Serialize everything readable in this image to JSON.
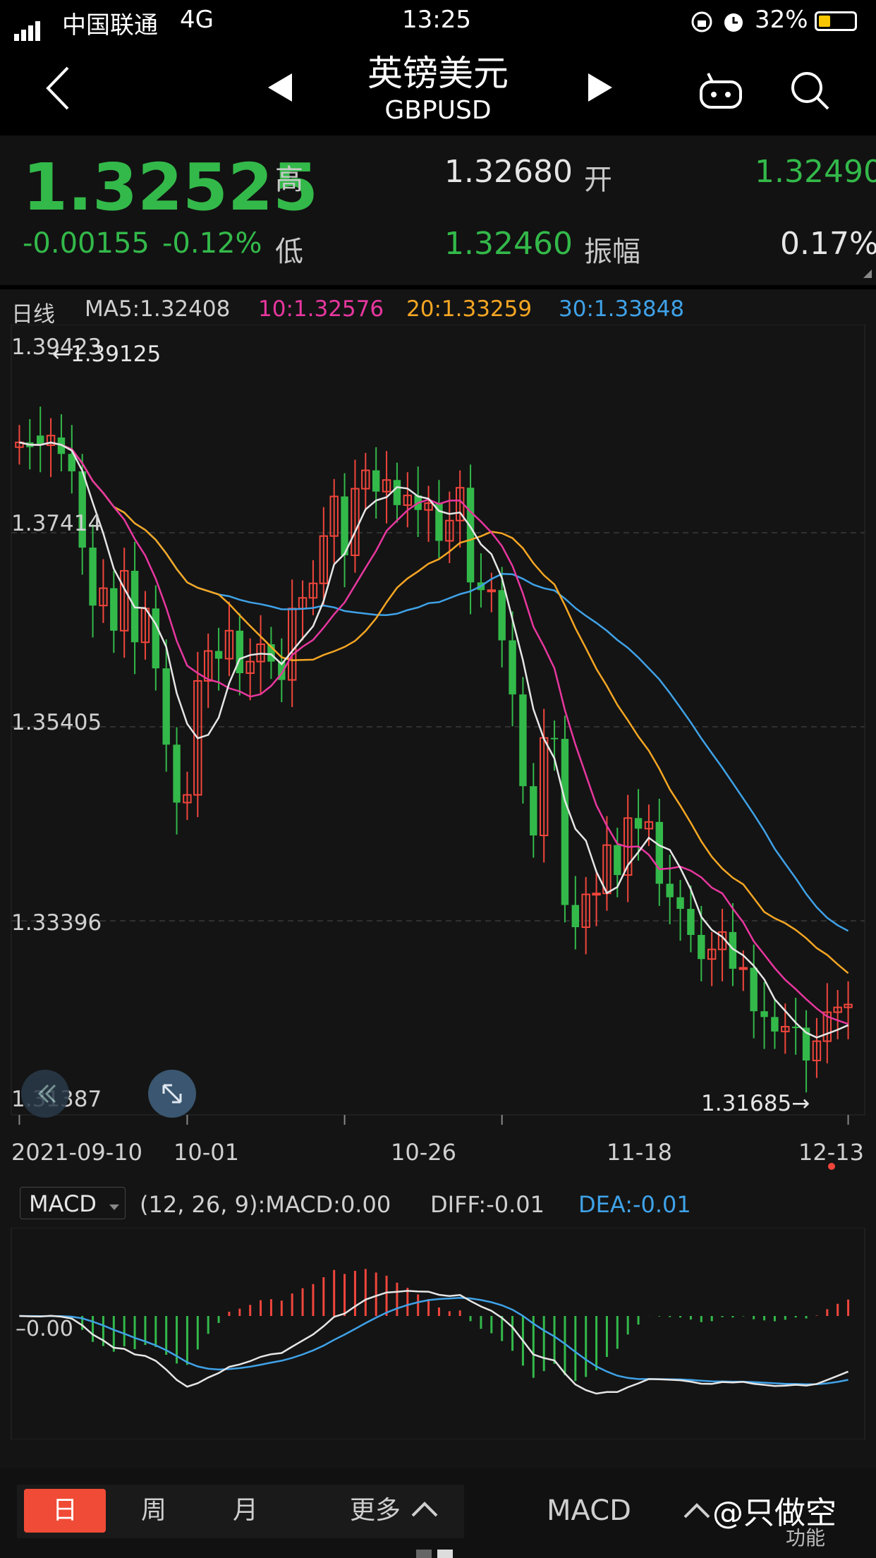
{
  "status": {
    "carrier": "中国联通",
    "network": "4G",
    "time": "13:25",
    "battery": "32%"
  },
  "nav": {
    "title": "英镑美元",
    "subtitle": "GBPUSD"
  },
  "quote": {
    "price": "1.32525",
    "change": "-0.00155",
    "change_pct": "-0.12%",
    "high_label": "高",
    "high_value": "1.32680",
    "low_label": "低",
    "low_value": "1.32460",
    "open_label": "开",
    "open_value": "1.32490",
    "amplitude_label": "振幅",
    "amplitude_value": "0.17%"
  },
  "ma": {
    "period": "日线",
    "ma5": "MA5:1.32408",
    "ma10": "10:1.32576",
    "ma20": "20:1.33259",
    "ma30": "30:1.33848"
  },
  "colors": {
    "up": "#f0463c",
    "down": "#33b94a",
    "ma5": "#e6e6e6",
    "ma10": "#e8379f",
    "ma20": "#f5a623",
    "ma30": "#3fa2e8",
    "grid": "#3a3a3a"
  },
  "price_axis": {
    "top": "1.39423",
    "mid1": "1.37414",
    "mid2": "1.35405",
    "mid3": "1.33396",
    "bottom": "1.31387"
  },
  "annotations": {
    "max": "←1.39125",
    "min": "1.31685→"
  },
  "dates": [
    "2021-09-10",
    "10-01",
    "10-26",
    "11-18",
    "12-13"
  ],
  "macd": {
    "selector": "MACD",
    "params": "(12, 26, 9):MACD:0.00",
    "diff": "DIFF:-0.01",
    "dea": "DEA:-0.01",
    "zero_label": "0.00"
  },
  "bottom_tabs": {
    "day": "日",
    "week": "周",
    "month": "月",
    "more": "更多",
    "indicator": "MACD",
    "watermark": "@只做空",
    "function": "功能"
  },
  "chart_data": {
    "type": "candlestick",
    "ylim": [
      1.31387,
      1.39423
    ],
    "ohlc_open": [
      1.383,
      1.3835,
      1.3842,
      1.3832,
      1.384,
      1.3823,
      1.3805,
      1.3726,
      1.3666,
      1.3684,
      1.364,
      1.3702,
      1.3628,
      1.3663,
      1.3601,
      1.3522,
      1.3462,
      1.347,
      1.3588,
      1.3619,
      1.3611,
      1.364,
      1.3596,
      1.3608,
      1.3626,
      1.3608,
      1.3589,
      1.3663,
      1.3674,
      1.3689,
      1.3738,
      1.3779,
      1.3718,
      1.3787,
      1.3806,
      1.3784,
      1.3796,
      1.377,
      1.378,
      1.3765,
      1.3772,
      1.3733,
      1.3754,
      1.3788,
      1.369,
      1.3682,
      1.3682,
      1.363,
      1.3574,
      1.3479,
      1.3428,
      1.3529,
      1.3528,
      1.3356,
      1.3333,
      1.3367,
      1.3368,
      1.3418,
      1.3387,
      1.3446,
      1.3435,
      1.3442,
      1.3378,
      1.3364,
      1.3352,
      1.3325,
      1.33,
      1.331,
      1.3328,
      1.329,
      1.3291,
      1.3246,
      1.324,
      1.3225,
      1.323,
      1.3229,
      1.3195,
      1.3215,
      1.3245,
      1.325
    ],
    "ohlc_close": [
      1.3835,
      1.383,
      1.3832,
      1.3842,
      1.3823,
      1.3805,
      1.3726,
      1.3666,
      1.3684,
      1.364,
      1.3702,
      1.3628,
      1.3663,
      1.3601,
      1.3522,
      1.3462,
      1.347,
      1.3588,
      1.3619,
      1.3611,
      1.364,
      1.3596,
      1.3608,
      1.3626,
      1.3608,
      1.3589,
      1.3663,
      1.3674,
      1.3689,
      1.3738,
      1.3779,
      1.3718,
      1.3787,
      1.3806,
      1.3784,
      1.3796,
      1.377,
      1.378,
      1.3765,
      1.3772,
      1.3733,
      1.3754,
      1.3788,
      1.369,
      1.3682,
      1.3682,
      1.363,
      1.3574,
      1.3479,
      1.3428,
      1.3529,
      1.3528,
      1.3356,
      1.3333,
      1.3367,
      1.3368,
      1.3418,
      1.3387,
      1.3446,
      1.3435,
      1.3442,
      1.3378,
      1.3364,
      1.3352,
      1.3325,
      1.33,
      1.331,
      1.3328,
      1.329,
      1.3291,
      1.3246,
      1.324,
      1.3225,
      1.323,
      1.3229,
      1.3195,
      1.3215,
      1.3245,
      1.325,
      1.3253
    ],
    "ma5_level": 1.32408,
    "ma10_level": 1.32576,
    "ma20_level": 1.33259,
    "ma30_level": 1.33848
  }
}
